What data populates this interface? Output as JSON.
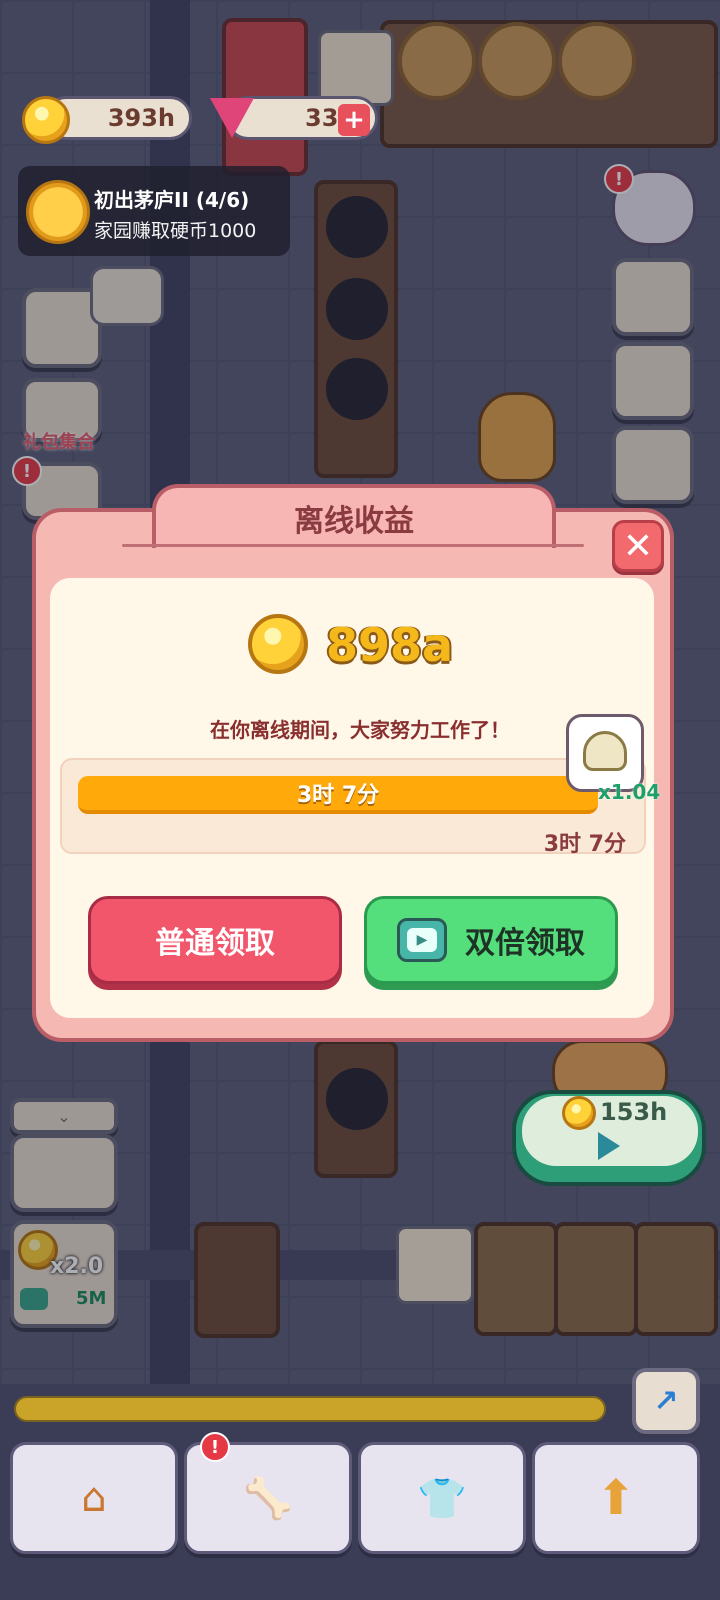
{
  "hud": {
    "coins": "393h",
    "gems": "33",
    "add_icon": "plus-icon"
  },
  "quest": {
    "title": "初出茅庐II (4/6)",
    "desc": "家园赚取硬币1000"
  },
  "side_left": {
    "gift_label": "礼包集合",
    "boost_multiplier": "x2.0",
    "boost_time": "5M"
  },
  "popup": {
    "title": "离线收益",
    "amount": "898a",
    "message": "在你离线期间，大家努力工作了！",
    "bar_label": "3时 7分",
    "bar_right_label": "3时 7分",
    "progress": 1.0,
    "pet_multiplier": "x1.04",
    "normal_button": "普通领取",
    "double_button": "双倍领取"
  },
  "right_panel": {
    "income": "153h"
  },
  "colors": {
    "accent_red": "#f2566b",
    "accent_green": "#55df7c",
    "coin_gold": "#ffd23a",
    "bar_orange": "#ffa90b"
  }
}
